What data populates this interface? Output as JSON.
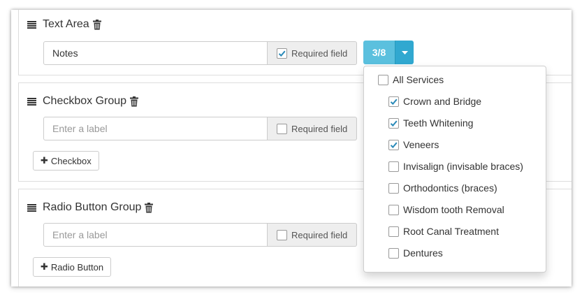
{
  "sections": {
    "text_area": {
      "title": "Text Area",
      "input_value": "Notes",
      "input_placeholder": "",
      "required_label": "Required field",
      "required_checked": true
    },
    "checkbox_group": {
      "title": "Checkbox Group",
      "input_placeholder": "Enter a label",
      "required_label": "Required field",
      "required_checked": false,
      "add_button": "Checkbox"
    },
    "radio_group": {
      "title": "Radio Button Group",
      "input_placeholder": "Enter a label",
      "required_label": "Required field",
      "required_checked": false,
      "add_button": "Radio Button"
    }
  },
  "multiselect": {
    "count_label": "3/8",
    "all_label": "All Services",
    "options": [
      {
        "label": "Crown and Bridge",
        "checked": true
      },
      {
        "label": "Teeth Whitening",
        "checked": true
      },
      {
        "label": "Veneers",
        "checked": true
      },
      {
        "label": "Invisalign (invisable braces)",
        "checked": false
      },
      {
        "label": "Orthodontics (braces)",
        "checked": false
      },
      {
        "label": "Wisdom tooth Removal",
        "checked": false
      },
      {
        "label": "Root Canal Treatment",
        "checked": false
      },
      {
        "label": "Dentures",
        "checked": false
      }
    ]
  },
  "icons": {
    "handle": "drag-handle-icon",
    "trash": "trash-icon",
    "plus": "plus-icon",
    "caret": "caret-down-icon",
    "check": "check-icon"
  },
  "colors": {
    "accent": "#5bc0de",
    "accent_dark": "#31a8d0",
    "check": "#2a8ab8",
    "addon_bg": "#eeeeee",
    "border": "#cccccc"
  }
}
